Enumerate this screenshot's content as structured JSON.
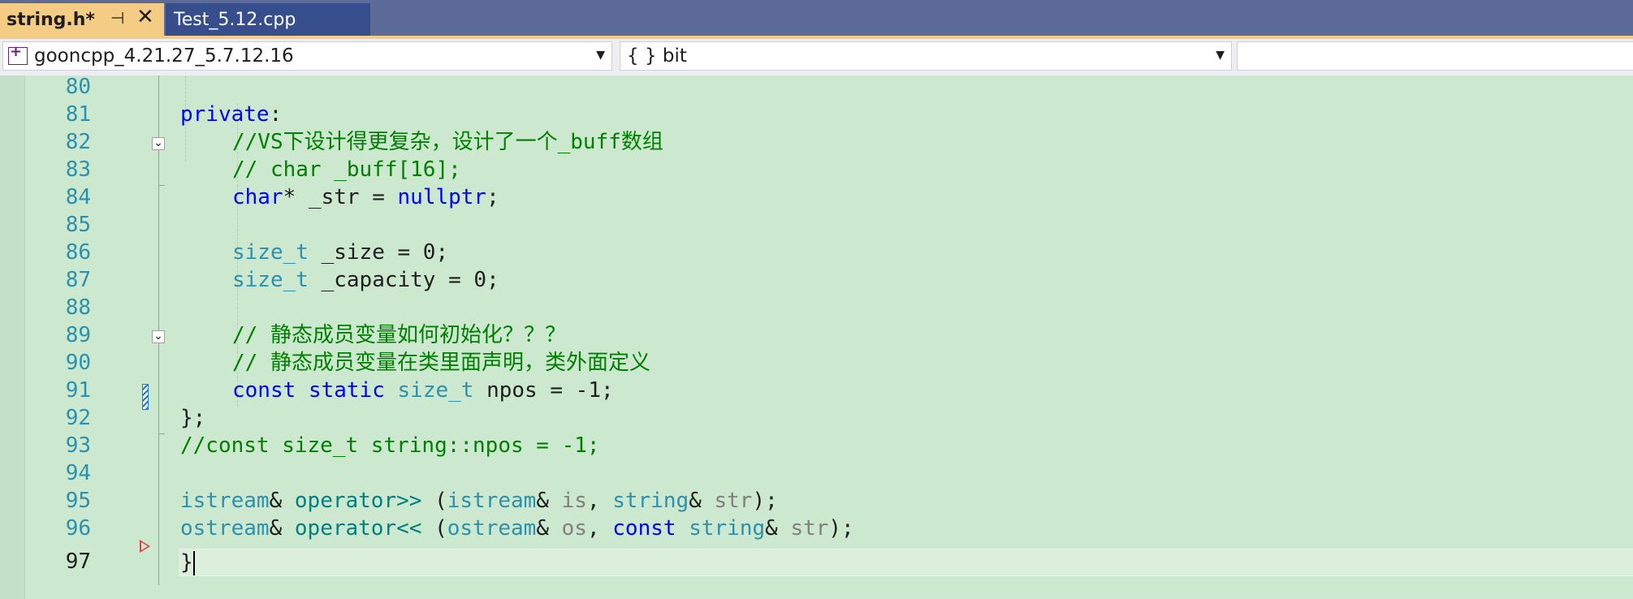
{
  "tabs": {
    "active": {
      "label": "string.h*",
      "pin_glyph": "⊣",
      "close_glyph": "✕"
    },
    "inactive": {
      "label": "Test_5.12.cpp"
    }
  },
  "navbar": {
    "project": "gooncpp_4.21.27_5.7.12.16",
    "scope": "{ } bit",
    "member": ""
  },
  "editor": {
    "line_numbers": [
      "80",
      "81",
      "82",
      "83",
      "84",
      "85",
      "86",
      "87",
      "88",
      "89",
      "90",
      "91",
      "92",
      "93",
      "94",
      "95",
      "96",
      "97"
    ],
    "lines": {
      "l81": {
        "kw": "private",
        "rest": ":"
      },
      "l82": {
        "comment": "//VS下设计得更复杂，设计了一个_buff数组"
      },
      "l83": {
        "comment": "// char _buff[16];"
      },
      "l84": {
        "kw": "char",
        "mid": "* _str = ",
        "kw2": "nullptr",
        "end": ";"
      },
      "l86": {
        "ty": "size_t",
        "rest": " _size = 0;"
      },
      "l87": {
        "ty": "size_t",
        "rest": " _capacity = 0;"
      },
      "l89": {
        "comment": "// 静态成员变量如何初始化？？？"
      },
      "l90": {
        "comment": "// 静态成员变量在类里面声明，类外面定义"
      },
      "l91": {
        "kw": "const",
        "kw2": "static",
        "ty": "size_t",
        "rest": " npos = -1;"
      },
      "l92": {
        "text": "};"
      },
      "l93": {
        "comment": "//const size_t string::npos = -1;"
      },
      "l95": {
        "ty1": "istream",
        "op": "& ",
        "fn": "operator>>",
        "p1": " (",
        "ty2": "istream",
        "a1": "& ",
        "pr1": "is",
        "comma": ", ",
        "ty3": "string",
        "a2": "& ",
        "pr2": "str",
        "end": ");"
      },
      "l96": {
        "ty1": "ostream",
        "op": "& ",
        "fn": "operator<<",
        "p1": " (",
        "ty2": "ostream",
        "a1": "& ",
        "pr1": "os",
        "comma": ", ",
        "kw": "const",
        "sp": " ",
        "ty3": "string",
        "a2": "& ",
        "pr2": "str",
        "end": ");"
      },
      "l97": {
        "text": "}"
      }
    }
  }
}
